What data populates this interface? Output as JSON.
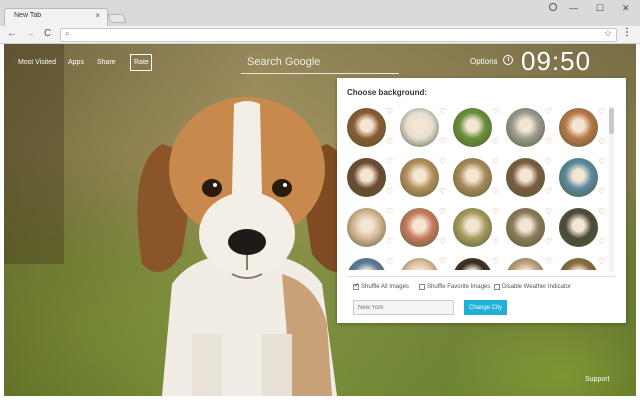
{
  "browser": {
    "tab_title": "New Tab",
    "tab_close": "×",
    "win_minimize": "—",
    "win_maximize": "☐",
    "win_close": "✕",
    "back": "←",
    "forward": "→",
    "reload": "C",
    "omni_icon": "⌕",
    "star": "☆",
    "menu": "⋮"
  },
  "page": {
    "nav": {
      "most_visited": "Most Visited",
      "apps": "Apps",
      "share": "Share",
      "rate": "Rate"
    },
    "search_placeholder": "Search Google",
    "options": "Options",
    "clock": "09:50",
    "support": "Support"
  },
  "panel": {
    "title": "Choose background:",
    "heart": "♡",
    "shuffle_all": "Shuffle All Images",
    "shuffle_all_checked": true,
    "shuffle_fav": "Shuffle Favorite Images",
    "shuffle_fav_checked": false,
    "disable_weather": "Disable Weather Indicator",
    "disable_weather_checked": false,
    "city_placeholder": "New York",
    "change_city": "Change City"
  },
  "thumbnail_colors": [
    [
      "#8a5a35",
      "#e6ded2",
      "#6a8f3a",
      "#9a9a90",
      "#b87848"
    ],
    [
      "#6b4a30",
      "#b6905c",
      "#a88a5a",
      "#7a5c40",
      "#5a8aa0"
    ],
    [
      "#d8b896",
      "#c87a60",
      "#a89a60",
      "#8a7a5a",
      "#4a4a3a"
    ],
    [
      "#5a7aa0",
      "#e0c0a0",
      "#3a2a20",
      "#c0a080",
      "#8a6a40"
    ]
  ]
}
